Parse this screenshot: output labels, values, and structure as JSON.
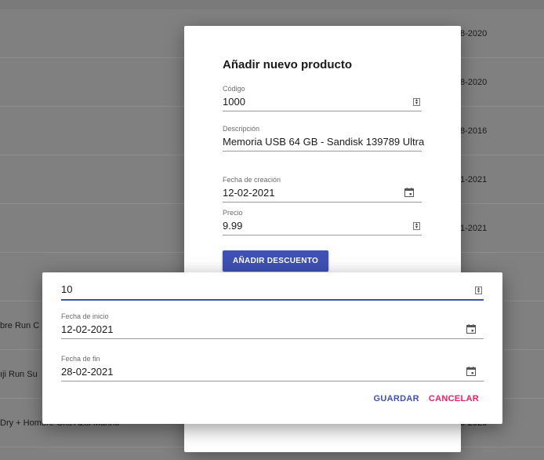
{
  "background_table": {
    "rows": [
      {
        "left": "",
        "right": "8-2020"
      },
      {
        "left": "",
        "right": "8-2020"
      },
      {
        "left": "",
        "right": "8-2016"
      },
      {
        "left": "",
        "right": "1-2021"
      },
      {
        "left": "",
        "right": "1-2021"
      },
      {
        "left": "",
        "right": ""
      },
      {
        "left": "bre Run C",
        "right": ""
      },
      {
        "left": "ıji Run Su",
        "right": ""
      },
      {
        "left": "Dry + Hombre Gris Azul Marino",
        "right": "0-2020"
      }
    ]
  },
  "product_dialog": {
    "title": "Añadir nuevo producto",
    "codigo": {
      "label": "Código",
      "value": "1000"
    },
    "descripcion": {
      "label": "Descripción",
      "value": "Memoria USB 64 GB - Sandisk 139789 Ultra"
    },
    "fecha_creacion": {
      "label": "Fecha de creación",
      "value": "12-02-2021"
    },
    "precio": {
      "label": "Precio",
      "value": "9.99"
    },
    "discount_button": "AÑADIR DESCUENTO"
  },
  "discount_dialog": {
    "amount": {
      "value": "10"
    },
    "fecha_inicio": {
      "label": "Fecha de inicio",
      "value": "12-02-2021"
    },
    "fecha_fin": {
      "label": "Fecha de fin",
      "value": "28-02-2021"
    },
    "save_label": "GUARDAR",
    "cancel_label": "CANCELAR"
  },
  "colors": {
    "primary": "#3f51b5",
    "accent": "#e91e63"
  },
  "icons": {
    "number_spinner": "spinner-icon",
    "date_picker": "calendar-icon"
  }
}
